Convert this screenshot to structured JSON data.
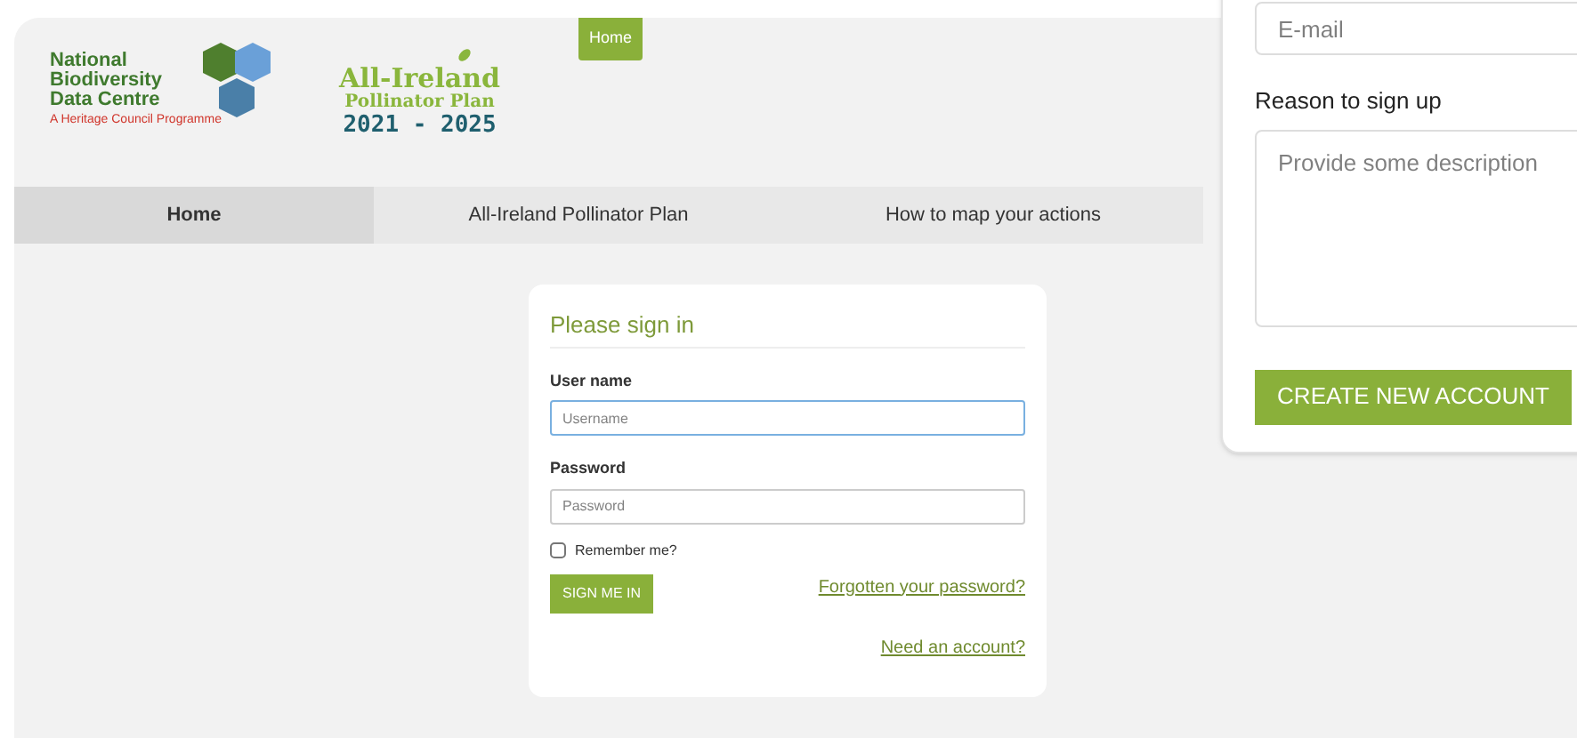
{
  "logos": {
    "nbdc": {
      "lines": [
        "National",
        "Biodiversity",
        "Data Centre"
      ],
      "tagline": "A Heritage Council Programme"
    },
    "aipp": {
      "title": "All-Ireland",
      "subtitle": "Pollinator Plan",
      "years": "2021 - 2025"
    }
  },
  "header_badge": "Home",
  "nav": [
    {
      "label": "Home",
      "selected": true
    },
    {
      "label": "All-Ireland Pollinator Plan",
      "selected": false
    },
    {
      "label": "How to map your actions",
      "selected": false
    }
  ],
  "signin": {
    "title": "Please sign in",
    "username_label": "User name",
    "username_placeholder": "Username",
    "password_label": "Password",
    "password_placeholder": "Password",
    "remember": {
      "label": "Remember me?",
      "checked": false
    },
    "submit": "SIGN ME IN",
    "forgot": "Forgotten your password?",
    "need_account": "Need an account?"
  },
  "signup_panel": {
    "email_placeholder": "E-mail",
    "reason_label": "Reason to sign up",
    "reason_placeholder": "Provide some description",
    "submit": "CREATE NEW ACCOUNT"
  }
}
